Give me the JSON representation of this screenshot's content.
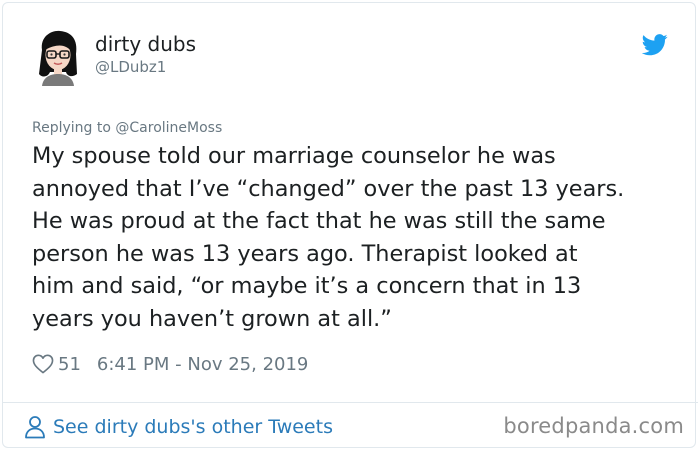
{
  "author": {
    "display_name": "dirty dubs",
    "handle": "@LDubz1"
  },
  "reply": {
    "prefix": "Replying to",
    "mention": "@CarolineMoss"
  },
  "tweet": {
    "text": "My spouse told our marriage counselor he was\nannoyed that I’ve “changed” over the past 13 years.\nHe was proud at the fact that he was still the same\nperson he was 13 years ago. Therapist looked at\nhim and said, “or maybe it’s a concern that in 13\nyears you haven’t grown at all.”",
    "likes": "51",
    "timestamp": "6:41 PM - Nov 25, 2019"
  },
  "footer": {
    "see_more_label": "See dirty dubs's other Tweets",
    "watermark": "boredpanda.com"
  },
  "icons": {
    "brand": "twitter-bird-icon",
    "like": "heart-icon",
    "profile": "person-icon"
  },
  "colors": {
    "twitter_blue": "#1da1f2",
    "link_blue": "#2b7bb9",
    "muted_text": "#697882",
    "body_text": "#1c2022",
    "border": "#e1e8ed",
    "watermark": "#8a8a8a"
  }
}
